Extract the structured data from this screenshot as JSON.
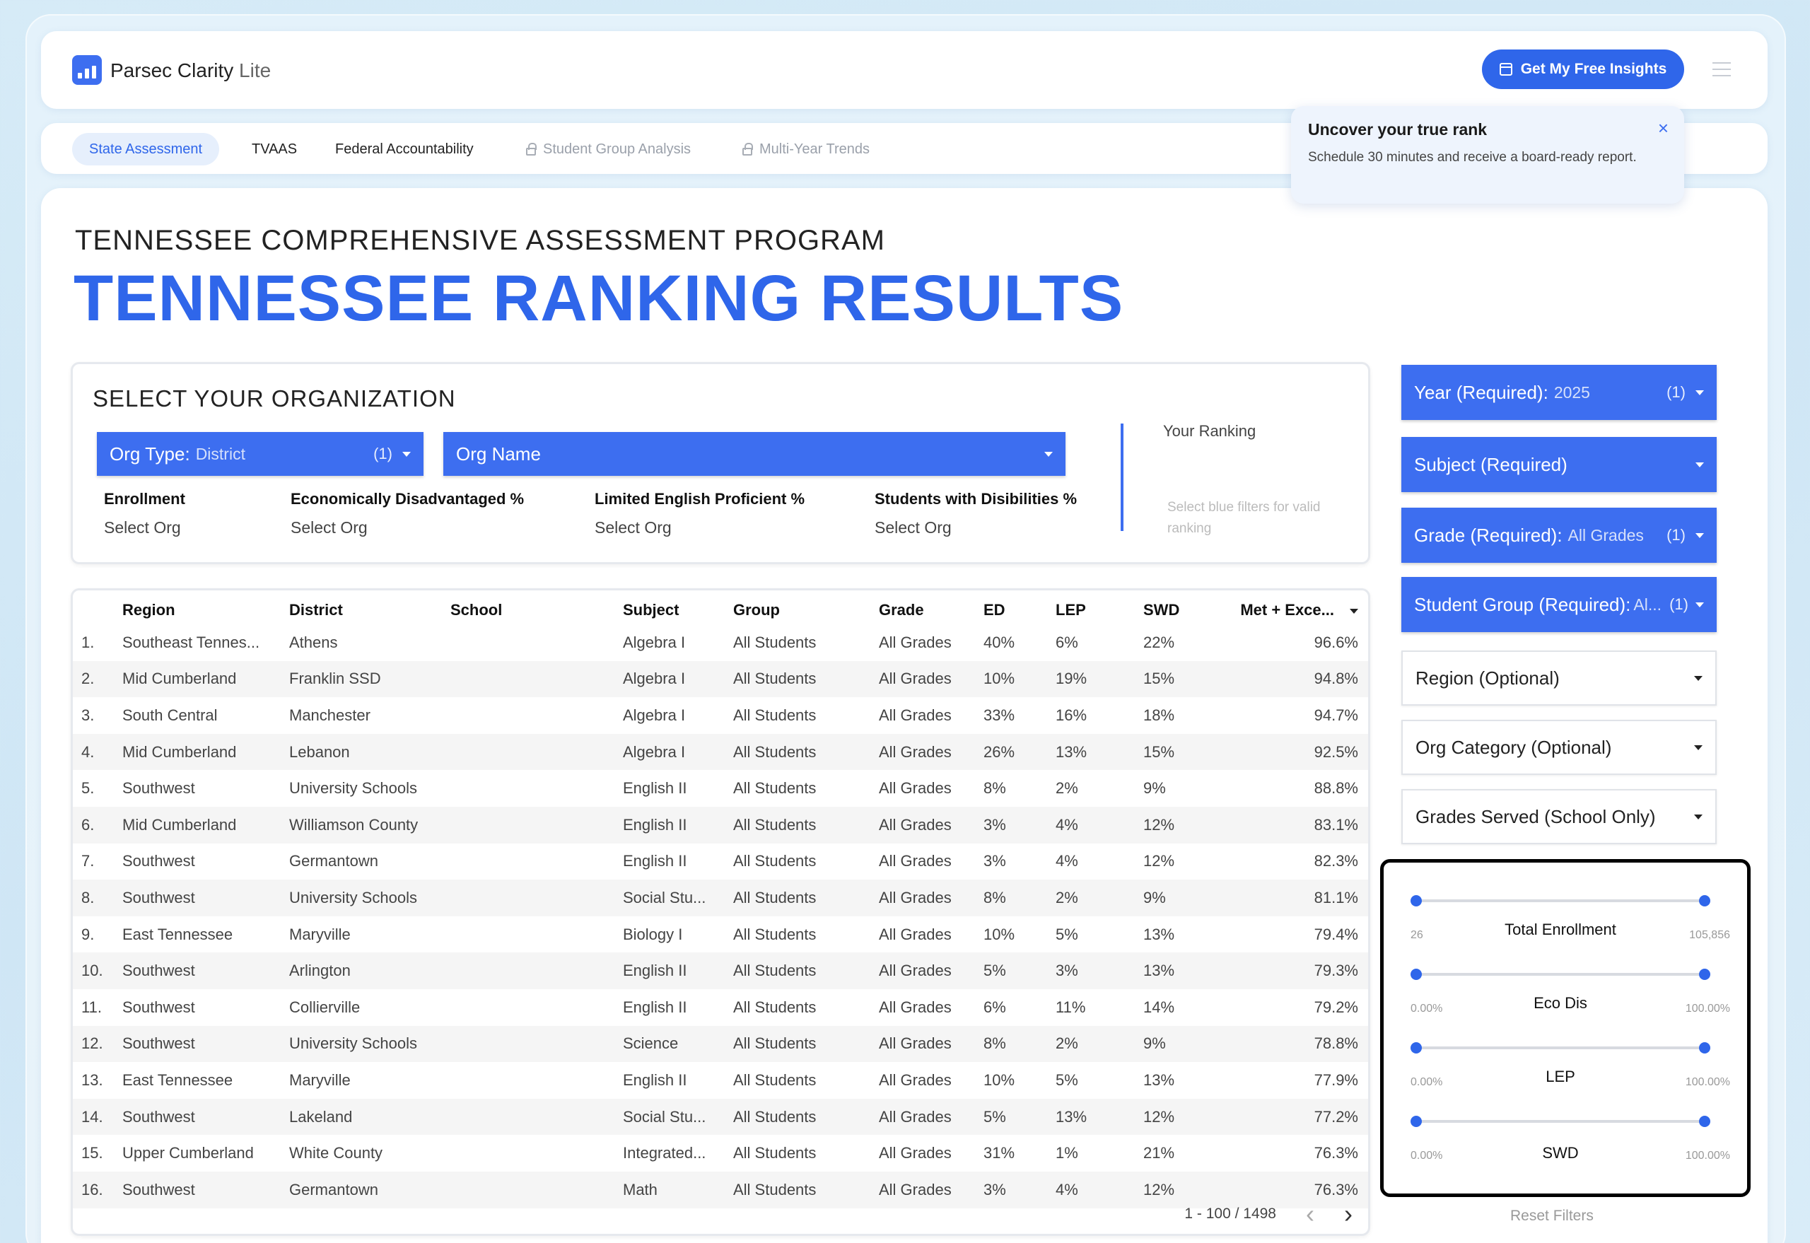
{
  "header": {
    "brand_name": "Parsec Clarity",
    "brand_suffix": "Lite",
    "cta_label": "Get My Free Insights",
    "icons": {
      "logo": "bar-chart-logo-icon",
      "cta": "calendar-icon",
      "menu": "hamburger-menu-icon"
    }
  },
  "tabs": [
    {
      "label": "State Assessment",
      "active": true,
      "locked": false
    },
    {
      "label": "TVAAS",
      "active": false,
      "locked": false
    },
    {
      "label": "Federal Accountability",
      "active": false,
      "locked": false
    },
    {
      "label": "Student Group Analysis",
      "active": false,
      "locked": true
    },
    {
      "label": "Multi-Year Trends",
      "active": false,
      "locked": true
    }
  ],
  "popup": {
    "title": "Uncover your true rank",
    "text": "Schedule 30 minutes and receive a board-ready report.",
    "close": "×"
  },
  "page": {
    "kicker": "TENNESSEE COMPREHENSIVE ASSESSMENT PROGRAM",
    "title": "TENNESSEE RANKING RESULTS"
  },
  "org": {
    "heading": "SELECT YOUR ORGANIZATION",
    "org_type_label": "Org Type:",
    "org_type_value": "District",
    "org_type_count": "(1)",
    "org_name_label": "Org Name",
    "stats": [
      {
        "label": "Enrollment",
        "value": "Select Org"
      },
      {
        "label": "Economically Disadvantaged %",
        "value": "Select Org"
      },
      {
        "label": "Limited English Proficient %",
        "value": "Select Org"
      },
      {
        "label": "Students with Disibilities %",
        "value": "Select Org"
      }
    ],
    "ranking_label": "Your Ranking",
    "ranking_hint": "Select blue filters for valid ranking"
  },
  "table": {
    "columns": [
      "Region",
      "District",
      "School",
      "Subject",
      "Group",
      "Grade",
      "ED",
      "LEP",
      "SWD",
      "Met + Exce..."
    ],
    "rows": [
      [
        "1.",
        "Southeast Tennes...",
        "Athens",
        "",
        "Algebra I",
        "All Students",
        "All Grades",
        "40%",
        "6%",
        "22%",
        "96.6%"
      ],
      [
        "2.",
        "Mid Cumberland",
        "Franklin SSD",
        "",
        "Algebra I",
        "All Students",
        "All Grades",
        "10%",
        "19%",
        "15%",
        "94.8%"
      ],
      [
        "3.",
        "South Central",
        "Manchester",
        "",
        "Algebra I",
        "All Students",
        "All Grades",
        "33%",
        "16%",
        "18%",
        "94.7%"
      ],
      [
        "4.",
        "Mid Cumberland",
        "Lebanon",
        "",
        "Algebra I",
        "All Students",
        "All Grades",
        "26%",
        "13%",
        "15%",
        "92.5%"
      ],
      [
        "5.",
        "Southwest",
        "University Schools",
        "",
        "English II",
        "All Students",
        "All Grades",
        "8%",
        "2%",
        "9%",
        "88.8%"
      ],
      [
        "6.",
        "Mid Cumberland",
        "Williamson County",
        "",
        "English II",
        "All Students",
        "All Grades",
        "3%",
        "4%",
        "12%",
        "83.1%"
      ],
      [
        "7.",
        "Southwest",
        "Germantown",
        "",
        "English II",
        "All Students",
        "All Grades",
        "3%",
        "4%",
        "12%",
        "82.3%"
      ],
      [
        "8.",
        "Southwest",
        "University Schools",
        "",
        "Social Stu...",
        "All Students",
        "All Grades",
        "8%",
        "2%",
        "9%",
        "81.1%"
      ],
      [
        "9.",
        "East Tennessee",
        "Maryville",
        "",
        "Biology I",
        "All Students",
        "All Grades",
        "10%",
        "5%",
        "13%",
        "79.4%"
      ],
      [
        "10.",
        "Southwest",
        "Arlington",
        "",
        "English II",
        "All Students",
        "All Grades",
        "5%",
        "3%",
        "13%",
        "79.3%"
      ],
      [
        "11.",
        "Southwest",
        "Collierville",
        "",
        "English II",
        "All Students",
        "All Grades",
        "6%",
        "11%",
        "14%",
        "79.2%"
      ],
      [
        "12.",
        "Southwest",
        "University Schools",
        "",
        "Science",
        "All Students",
        "All Grades",
        "8%",
        "2%",
        "9%",
        "78.8%"
      ],
      [
        "13.",
        "East Tennessee",
        "Maryville",
        "",
        "English II",
        "All Students",
        "All Grades",
        "10%",
        "5%",
        "13%",
        "77.9%"
      ],
      [
        "14.",
        "Southwest",
        "Lakeland",
        "",
        "Social Stu...",
        "All Students",
        "All Grades",
        "5%",
        "13%",
        "12%",
        "77.2%"
      ],
      [
        "15.",
        "Upper Cumberland",
        "White County",
        "",
        "Integrated...",
        "All Students",
        "All Grades",
        "31%",
        "1%",
        "21%",
        "76.3%"
      ],
      [
        "16.",
        "Southwest",
        "Germantown",
        "",
        "Math",
        "All Students",
        "All Grades",
        "3%",
        "4%",
        "12%",
        "76.3%"
      ]
    ],
    "pagination": "1 - 100 / 1498"
  },
  "filters": {
    "blue": [
      {
        "label": "Year (Required):",
        "value": "2025",
        "count": "(1)"
      },
      {
        "label": "Subject (Required)",
        "value": "",
        "count": ""
      },
      {
        "label": "Grade (Required):",
        "value": "All Grades",
        "count": "(1)"
      },
      {
        "label": "Student Group (Required):",
        "value": "Al...",
        "count": "(1)"
      }
    ],
    "white": [
      {
        "label": "Region (Optional)"
      },
      {
        "label": "Org Category (Optional)"
      },
      {
        "label": "Grades Served (School Only)"
      }
    ]
  },
  "sliders": [
    {
      "title": "Total Enrollment",
      "min": "26",
      "max": "105,856"
    },
    {
      "title": "Eco Dis",
      "min": "0.00%",
      "max": "100.00%"
    },
    {
      "title": "LEP",
      "min": "0.00%",
      "max": "100.00%"
    },
    {
      "title": "SWD",
      "min": "0.00%",
      "max": "100.00%"
    }
  ],
  "reset_label": "Reset Filters",
  "colors": {
    "accent": "#2f66ea",
    "filter_blue": "#3d6ef0"
  }
}
